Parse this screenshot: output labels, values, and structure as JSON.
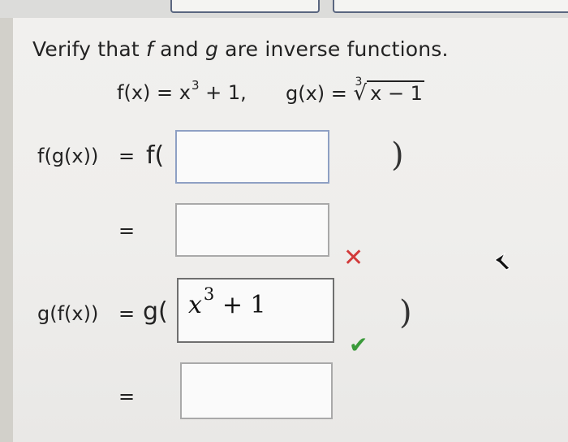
{
  "question": {
    "title_prefix": "Verify that ",
    "f": "f",
    "and": " and ",
    "g": "g",
    "title_suffix": " are inverse functions."
  },
  "formulas": {
    "f_def_lhs": "f(x) = x",
    "f_def_exp": "3",
    "f_def_rest": " + 1,",
    "g_def_lhs": "g(x) = ",
    "g_root_index": "3",
    "g_radicand": "x − 1"
  },
  "rows": {
    "fg_label": "f(g(x))",
    "equals": "=",
    "f_open": "f(",
    "close_paren": ")",
    "gf_label": "g(f(x))",
    "g_open": "g(",
    "gf_inner_base": "x",
    "gf_inner_exp": "3",
    "gf_inner_rest": " + 1",
    "fg_inner_value": "",
    "fg_result_value": "",
    "gf_result_value": ""
  },
  "feedback": {
    "incorrect_icon": "x-icon",
    "correct_icon": "check-icon",
    "incorrect_color": "#d23a3a",
    "correct_color": "#3a9a3a"
  }
}
